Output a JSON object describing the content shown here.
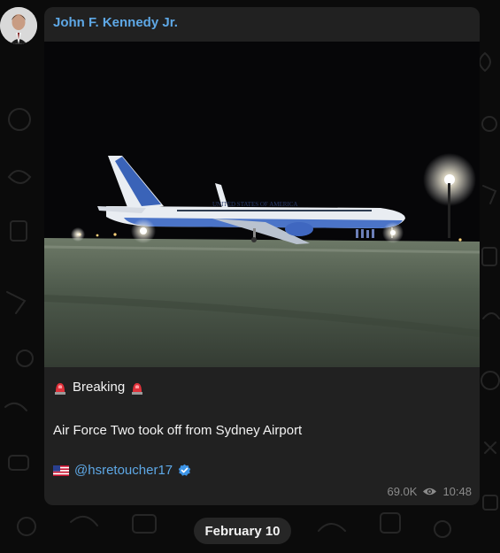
{
  "message": {
    "sender": "John F. Kennedy Jr.",
    "breaking_label": "Breaking",
    "text": "Air Force Two took off from Sydney Airport",
    "handle": "@hsretoucher17",
    "views": "69.0K",
    "time": "10:48"
  },
  "date_separator": "February 10",
  "icons": {
    "siren": "police-car-light-emoji",
    "flag": "us-flag-emoji",
    "verified": "verified-badge-icon",
    "views": "eye-icon"
  },
  "colors": {
    "bubble_bg": "#212121",
    "link": "#5ea8e6",
    "meta": "#8b8b8b"
  }
}
